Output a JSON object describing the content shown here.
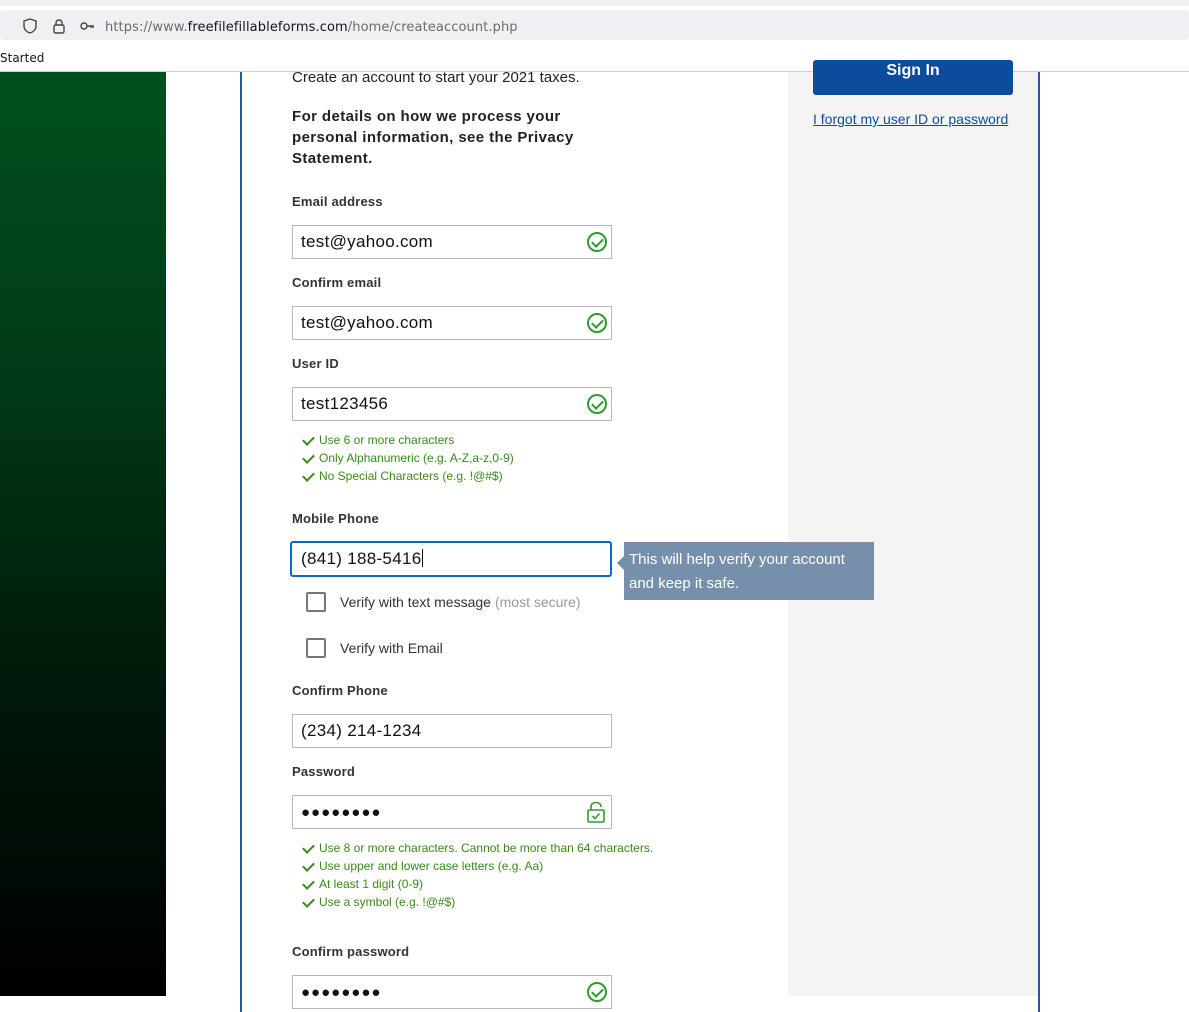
{
  "browser": {
    "url_prefix": "https://www.",
    "url_domain": "freefilefillableforms.com",
    "url_path": "/home/createaccount.php",
    "bookmark_item": "Started"
  },
  "sidebar": {
    "signin_label": "Sign In",
    "forgot_link": "I forgot my user ID or password"
  },
  "form": {
    "intro": "Create an account to start your 2021 taxes.",
    "privacy": "For details on how we process your personal information, see the Privacy Statement.",
    "email_label": "Email address",
    "email_value": "test@yahoo.com",
    "confirm_email_label": "Confirm email",
    "confirm_email_value": "test@yahoo.com",
    "userid_label": "User ID",
    "userid_value": "test123456",
    "userid_rules": [
      "Use 6 or more characters",
      "Only Alphanumeric (e.g. A-Z,a-z,0-9)",
      "No Special Characters (e.g. !@#$)"
    ],
    "mobile_label": "Mobile Phone",
    "mobile_value": "(841) 188-5416",
    "tooltip": "This will help verify your account and keep it safe.",
    "verify_text_label": "Verify with text message",
    "verify_text_note": "(most secure)",
    "verify_email_label": "Verify with Email",
    "confirm_phone_label": "Confirm Phone",
    "confirm_phone_value": "(234) 214-1234",
    "password_label": "Password",
    "password_value": "●●●●●●●●",
    "password_rules": [
      "Use 8 or more characters. Cannot be more than 64 characters.",
      "Use upper and lower case letters (e.g. Aa)",
      "At least 1 digit (0-9)",
      "Use a symbol (e.g. !@#$)"
    ],
    "confirm_password_label": "Confirm password",
    "confirm_password_value": "●●●●●●●●"
  },
  "colors": {
    "accent": "#0d4c9c",
    "success": "#2e9a2e",
    "tooltip": "#7690ac"
  }
}
